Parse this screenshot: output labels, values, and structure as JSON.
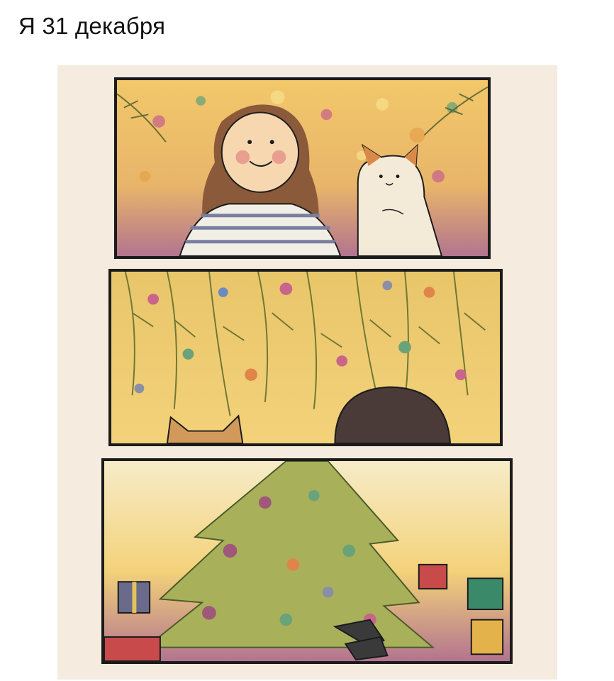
{
  "post": {
    "caption": "Я 31 декабря"
  },
  "comic": {
    "panels": [
      {
        "scene": "girl-and-cat-looking-up"
      },
      {
        "scene": "tree-branches-from-below"
      },
      {
        "scene": "lying-under-christmas-tree"
      }
    ],
    "colors": {
      "paper": "#f5ecdf",
      "ink": "#1b1b1b",
      "warm_yellow": "#f3c95a",
      "purple": "#b26a8a",
      "green": "#8aa35a"
    }
  }
}
